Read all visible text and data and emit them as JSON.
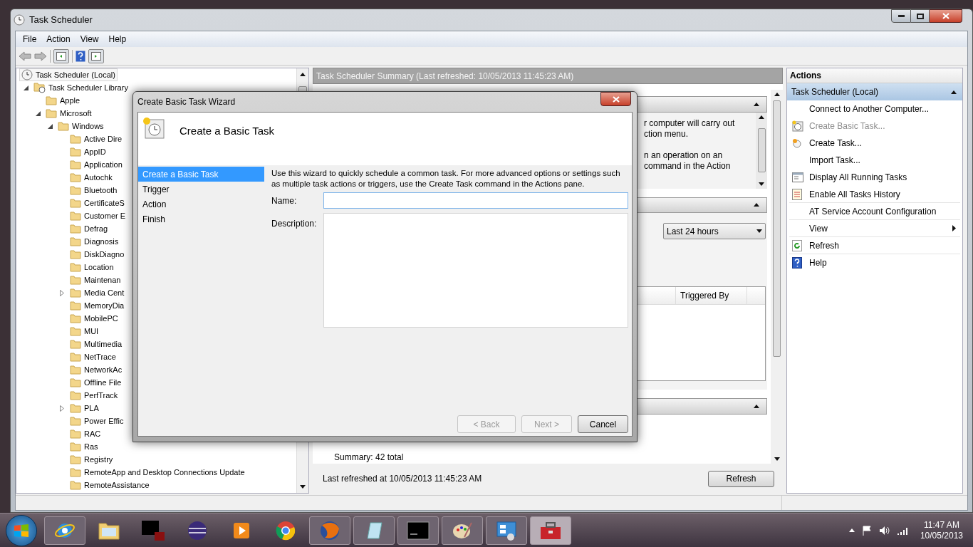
{
  "window": {
    "title": "Task Scheduler"
  },
  "menu": [
    "File",
    "Action",
    "View",
    "Help"
  ],
  "tree": [
    {
      "label": "Task Scheduler (Local)",
      "selected": true,
      "children": [
        {
          "label": "Task Scheduler Library",
          "kind": "library",
          "expanded": true,
          "selected": false,
          "children": [
            {
              "label": "Apple",
              "kind": "folder",
              "selected": false
            },
            {
              "label": "Microsoft",
              "kind": "folder",
              "expanded": true,
              "selected": false,
              "children": [
                {
                  "label": "Windows",
                  "kind": "folder",
                  "expanded": true,
                  "selected": false,
                  "children": [
                    {
                      "label": "Active Dire",
                      "kind": "folder",
                      "selected": false
                    },
                    {
                      "label": "AppID",
                      "kind": "folder",
                      "selected": false
                    },
                    {
                      "label": "Application",
                      "kind": "folder",
                      "selected": false
                    },
                    {
                      "label": "Autochk",
                      "kind": "folder",
                      "selected": false
                    },
                    {
                      "label": "Bluetooth",
                      "kind": "folder",
                      "selected": false
                    },
                    {
                      "label": "CertificateS",
                      "kind": "folder",
                      "selected": false
                    },
                    {
                      "label": "Customer E",
                      "kind": "folder",
                      "selected": false
                    },
                    {
                      "label": "Defrag",
                      "kind": "folder",
                      "selected": false
                    },
                    {
                      "label": "Diagnosis",
                      "kind": "folder",
                      "selected": false
                    },
                    {
                      "label": "DiskDiagno",
                      "kind": "folder",
                      "selected": false
                    },
                    {
                      "label": "Location",
                      "kind": "folder",
                      "selected": false
                    },
                    {
                      "label": "Maintenan",
                      "kind": "folder",
                      "selected": false
                    },
                    {
                      "label": "Media Cent",
                      "kind": "folder",
                      "expanded": false,
                      "selected": false
                    },
                    {
                      "label": "MemoryDia",
                      "kind": "folder",
                      "selected": false
                    },
                    {
                      "label": "MobilePC",
                      "kind": "folder",
                      "selected": false
                    },
                    {
                      "label": "MUI",
                      "kind": "folder",
                      "selected": false
                    },
                    {
                      "label": "Multimedia",
                      "kind": "folder",
                      "selected": false
                    },
                    {
                      "label": "NetTrace",
                      "kind": "folder",
                      "selected": false
                    },
                    {
                      "label": "NetworkAc",
                      "kind": "folder",
                      "selected": false
                    },
                    {
                      "label": "Offline File",
                      "kind": "folder",
                      "selected": false
                    },
                    {
                      "label": "PerfTrack",
                      "kind": "folder",
                      "selected": false
                    },
                    {
                      "label": "PLA",
                      "kind": "folder",
                      "expanded": false,
                      "selected": false
                    },
                    {
                      "label": "Power Effic",
                      "kind": "folder",
                      "selected": false
                    },
                    {
                      "label": "RAC",
                      "kind": "folder",
                      "selected": false
                    },
                    {
                      "label": "Ras",
                      "kind": "folder",
                      "selected": false
                    },
                    {
                      "label": "Registry",
                      "kind": "folder",
                      "selected": false
                    },
                    {
                      "label": "RemoteApp and Desktop Connections Update",
                      "kind": "folder",
                      "selected": false
                    },
                    {
                      "label": "RemoteAssistance",
                      "kind": "folder",
                      "selected": false
                    }
                  ]
                }
              ]
            }
          ]
        }
      ]
    }
  ],
  "summary": {
    "title": "Task Scheduler Summary (Last refreshed: 10/05/2013 11:45:23 AM)",
    "overview_lines": [
      "r computer will carry out",
      "ction menu.",
      "n an operation on an",
      "command in the Action"
    ],
    "period": "Last 24 hours",
    "table_columns": [
      "Triggered By"
    ],
    "total": "Summary: 42 total",
    "last_refreshed": "Last refreshed at 10/05/2013 11:45:23 AM",
    "refresh_button": "Refresh"
  },
  "actions": {
    "title": "Actions",
    "group": {
      "label": "Task Scheduler (Local)",
      "expanded": true
    },
    "items": [
      {
        "label": "Connect to Another Computer...",
        "kind": "plain",
        "disabled": false,
        "divider": false
      },
      {
        "label": "Create Basic Task...",
        "kind": "basic-task",
        "disabled": true,
        "divider": false
      },
      {
        "label": "Create Task...",
        "kind": "task",
        "disabled": false,
        "divider": false
      },
      {
        "label": "Import Task...",
        "kind": "plain",
        "disabled": false,
        "divider": false
      },
      {
        "label": "Display All Running Tasks",
        "kind": "running",
        "disabled": false,
        "divider": false
      },
      {
        "label": "Enable All Tasks History",
        "kind": "history",
        "disabled": false,
        "divider": true
      },
      {
        "label": "AT Service Account Configuration",
        "kind": "plain",
        "disabled": false,
        "divider": true
      },
      {
        "label": "View",
        "kind": "submenu",
        "disabled": false,
        "divider": true
      },
      {
        "label": "Refresh",
        "kind": "refresh",
        "disabled": false,
        "divider": true
      },
      {
        "label": "Help",
        "kind": "help",
        "disabled": false,
        "divider": false
      }
    ]
  },
  "wizard": {
    "title": "Create Basic Task Wizard",
    "heading": "Create a Basic Task",
    "steps": [
      {
        "label": "Create a Basic Task",
        "selected": true
      },
      {
        "label": "Trigger",
        "selected": false
      },
      {
        "label": "Action",
        "selected": false
      },
      {
        "label": "Finish",
        "selected": false
      }
    ],
    "intro": "Use this wizard to quickly schedule a common task. For more advanced options or settings such as multiple task actions or triggers, use the Create Task command in the Actions pane.",
    "name_label": "Name:",
    "description_label": "Description:",
    "buttons": [
      {
        "label": "< Back",
        "disabled": true
      },
      {
        "label": "Next >",
        "disabled": true
      },
      {
        "label": "Cancel",
        "disabled": false
      }
    ]
  },
  "taskbar": {
    "apps": [
      {
        "kind": "orbit",
        "running": true,
        "active": false
      },
      {
        "kind": "folder",
        "running": false,
        "active": false
      },
      {
        "kind": "window",
        "running": false,
        "active": false
      },
      {
        "kind": "sphere",
        "running": false,
        "active": false
      },
      {
        "kind": "play",
        "running": false,
        "active": false
      },
      {
        "kind": "wheel",
        "running": false,
        "active": false
      },
      {
        "kind": "globe",
        "running": true,
        "active": false
      },
      {
        "kind": "notepad",
        "running": true,
        "active": false
      },
      {
        "kind": "terminal",
        "running": true,
        "active": false
      },
      {
        "kind": "palette",
        "running": true,
        "active": false
      },
      {
        "kind": "panel",
        "running": true,
        "active": false
      },
      {
        "kind": "toolbox",
        "running": true,
        "active": true
      }
    ],
    "time": "11:47 AM",
    "date": "10/05/2013"
  }
}
